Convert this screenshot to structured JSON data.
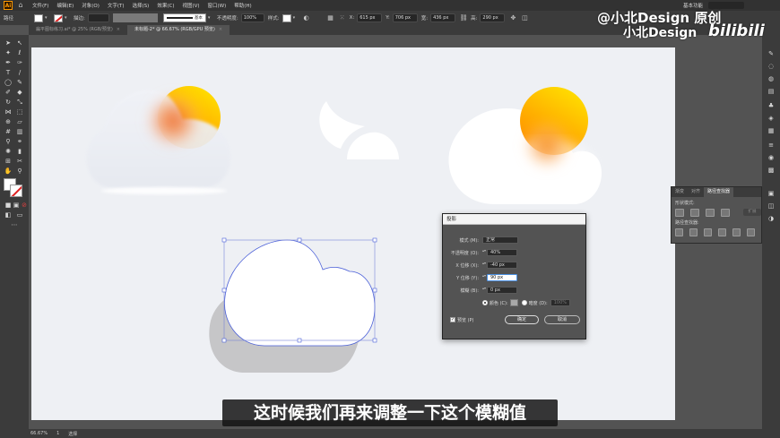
{
  "menubar": {
    "app_logo": "Ai",
    "items": [
      "文件(F)",
      "编辑(E)",
      "对象(O)",
      "文字(T)",
      "选择(S)",
      "效果(C)",
      "视图(V)",
      "窗口(W)",
      "帮助(H)"
    ],
    "workspace": "基本功能"
  },
  "control": {
    "path_label": "路径",
    "stroke_label": "描边:",
    "stroke_style": "基本",
    "opacity_label": "不透明度:",
    "opacity_value": "100%",
    "style_label": "样式:",
    "x_label": "X:",
    "x_value": "615 px",
    "y_label": "Y:",
    "y_value": "706 px",
    "w_label": "宽:",
    "w_value": "436 px",
    "h_label": "高:",
    "h_value": "290 px"
  },
  "tabs": [
    {
      "label": "扁平图标练习.ai* @ 25% (RGB/预览)",
      "active": false
    },
    {
      "label": "未标题-2* @ 66.67% (RGB/GPU 预览)",
      "active": true
    }
  ],
  "status": {
    "zoom": "66.67%",
    "page": "1",
    "tool": "选择"
  },
  "pathfinder": {
    "tabs": [
      "渐变",
      "对齐",
      "路径查找器"
    ],
    "shape_modes_label": "形状模式:",
    "pathfinders_label": "路径查找器:",
    "apply_label": "扩展"
  },
  "dialog": {
    "title": "投影",
    "mode_label": "模式 (M):",
    "mode_value": "正常",
    "opacity_label": "不透明度 (O):",
    "opacity_value": "40%",
    "x_offset_label": "X 位移 (X):",
    "x_offset_value": "-40 px",
    "y_offset_label": "Y 位移 (Y):",
    "y_offset_value": "90 px",
    "blur_label": "模糊 (B):",
    "blur_value": "0 px",
    "color_label": "颜色 (C):",
    "darkness_label": "暗度 (D):",
    "darkness_value": "100%",
    "preview_label": "预览 (P)",
    "ok_label": "确定",
    "cancel_label": "取消"
  },
  "watermark": {
    "line1": "@小北Design  原创",
    "line2": "小北Design",
    "site": "bilibili"
  },
  "subtitle": "这时候我们再来调整一下这个模糊值",
  "colors": {
    "sun_top": "#ffe100",
    "sun_mid": "#ffb400",
    "sun_glow": "#f06a28",
    "cloud": "#ffffff",
    "shadow": "#c6c6c8",
    "selection": "#4a5fd8"
  }
}
